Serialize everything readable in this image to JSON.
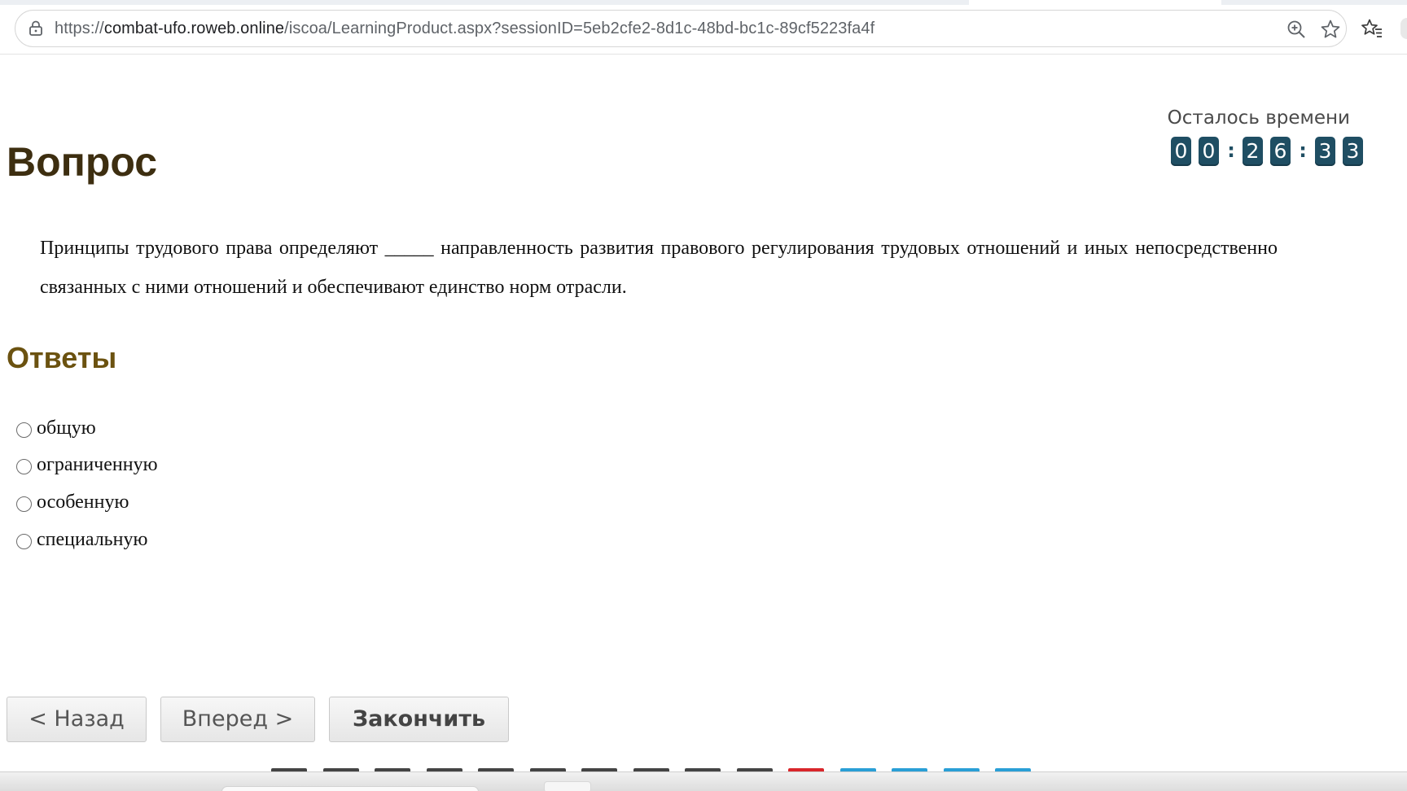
{
  "browser": {
    "url_prefix": "https://",
    "url_host": "combat-ufo.roweb.online",
    "url_path": "/iscoa/LearningProduct.aspx?sessionID=5eb2cfe2-8d1c-48bd-bc1c-89cf5223fa4f",
    "icons": {
      "site_info": "site-info-icon",
      "zoom": "zoom-icon",
      "bookmark": "star-icon",
      "favorites": "favorites-icon"
    }
  },
  "question": {
    "heading": "Вопрос",
    "text": "Принципы трудового права определяют _____ направленность развития правового регулирования трудовых отношений и иных непосредственно связанных с ними отношений и обеспечивают единство норм отрасли."
  },
  "timer": {
    "label": "Осталось времени",
    "digits": [
      "0",
      "0",
      "2",
      "6",
      "3",
      "3"
    ],
    "separator": ":"
  },
  "answers": {
    "heading": "Ответы",
    "options": [
      {
        "label": "общую",
        "selected": false
      },
      {
        "label": "ограниченную",
        "selected": false
      },
      {
        "label": "особенную",
        "selected": false
      },
      {
        "label": "специальную",
        "selected": false
      }
    ]
  },
  "buttons": {
    "back": "< Назад",
    "next": "Вперед >",
    "finish": "Закончить"
  },
  "colors": {
    "question_heading": "#3d2e10",
    "answers_heading": "#6b5210",
    "timer_digit_bg": "#1f4e63",
    "nav_strip": [
      "#444444",
      "#444444",
      "#444444",
      "#444444",
      "#444444",
      "#444444",
      "#444444",
      "#444444",
      "#444444",
      "#444444",
      "#d9262b",
      "#2a9fd6",
      "#2a9fd6",
      "#2a9fd6",
      "#2a9fd6"
    ]
  }
}
